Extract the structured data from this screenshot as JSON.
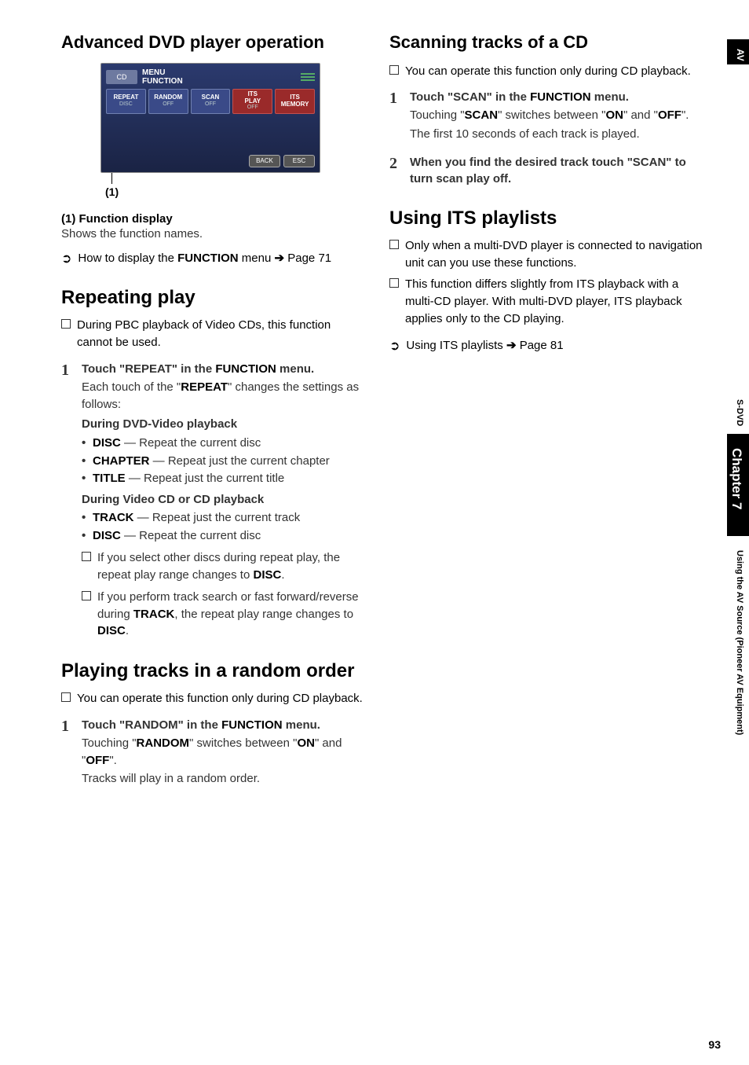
{
  "side": {
    "av": "AV",
    "sdvd": "S-DVD",
    "chapter": "Chapter 7",
    "using": "Using the AV Source (Pioneer AV Equipment)"
  },
  "page_number": "93",
  "left": {
    "title": "Advanced DVD player operation",
    "figure": {
      "menu_label1": "MENU",
      "menu_label2": "FUNCTION",
      "disc_icon": "CD",
      "tabs": [
        {
          "top": "REPEAT",
          "bottom": "DISC"
        },
        {
          "top": "RANDOM",
          "bottom": "OFF"
        },
        {
          "top": "SCAN",
          "bottom": "OFF"
        },
        {
          "top": "ITS\nPLAY",
          "bottom": "OFF"
        },
        {
          "top": "ITS\nMEMORY",
          "bottom": ""
        }
      ],
      "back": "BACK",
      "esc": "ESC",
      "callout": "(1)"
    },
    "func_disp_label": "(1) Function display",
    "func_disp_body": "Shows the function names.",
    "link1": "How to display the FUNCTION menu ➔ Page 71",
    "repeating": {
      "title": "Repeating play",
      "note": "During PBC playback of Video CDs, this function cannot be used.",
      "step1_head": "Touch \"REPEAT\" in the FUNCTION menu.",
      "step1_body": "Each touch of the \"REPEAT\" changes the settings as follows:",
      "subhead_dvd": "During DVD-Video playback",
      "bullets_dvd": [
        "DISC — Repeat the current disc",
        "CHAPTER — Repeat just the current chapter",
        "TITLE — Repeat just the current title"
      ],
      "subhead_cd": "During Video CD or CD playback",
      "bullets_cd": [
        "TRACK — Repeat just the current track",
        "DISC — Repeat the current disc"
      ],
      "note2": "If you select other discs during repeat play, the repeat play range changes to DISC.",
      "note3": "If you perform track search or fast forward/reverse during TRACK, the repeat play range changes to DISC."
    },
    "random": {
      "title": "Playing tracks in a random order",
      "note": "You can operate this function only during CD playback.",
      "step1_head": "Touch \"RANDOM\" in the FUNCTION menu.",
      "step1_body1": "Touching \"RANDOM\" switches between \"ON\" and \"OFF\".",
      "step1_body2": "Tracks will play in a random order."
    }
  },
  "right": {
    "scanning": {
      "title": "Scanning tracks of a CD",
      "note": "You can operate this function only during CD playback.",
      "step1_head": "Touch \"SCAN\" in the FUNCTION menu.",
      "step1_body1": "Touching \"SCAN\" switches between \"ON\" and \"OFF\".",
      "step1_body2": "The first 10 seconds of each track is played.",
      "step2_head": "When you find the desired track touch \"SCAN\" to turn scan play off."
    },
    "its": {
      "title": "Using ITS playlists",
      "note1": "Only when a multi-DVD player is connected to navigation unit can you use these functions.",
      "note2": "This function differs slightly from ITS playback with a multi-CD player. With multi-DVD player, ITS playback applies only to the CD playing.",
      "link": "Using ITS playlists ➔ Page 81"
    }
  }
}
